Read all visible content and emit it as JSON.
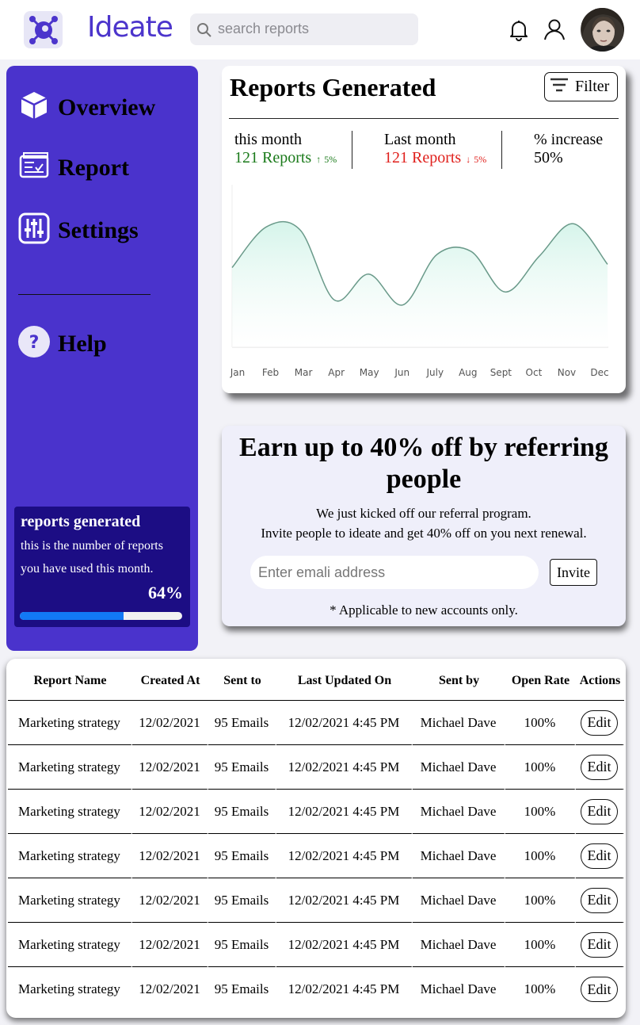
{
  "header": {
    "brand": "Ideate",
    "search_placeholder": "search reports"
  },
  "sidebar": {
    "items": [
      {
        "label": "Overview",
        "icon": "box-icon"
      },
      {
        "label": "Report",
        "icon": "report-icon"
      },
      {
        "label": "Settings",
        "icon": "sliders-icon"
      },
      {
        "label": "Help",
        "icon": "help-icon"
      }
    ],
    "usage": {
      "title": "reports generated",
      "desc_line1": "this is the number of reports",
      "desc_line2": "you have used this month.",
      "percent_label": "64%",
      "percent_value": 0.64
    }
  },
  "reports": {
    "title": "Reports Generated",
    "filter_label": "Filter",
    "stats": [
      {
        "label": "this month",
        "value": "121 Reports",
        "change": "5%",
        "direction": "up",
        "color": "#1a7a1a"
      },
      {
        "label": "Last month",
        "value": "121 Reports",
        "change": "5%",
        "direction": "down",
        "color": "#e0201c"
      },
      {
        "label": "% increase",
        "value": "50%"
      }
    ],
    "arrow_up": "↑",
    "arrow_down": "↓"
  },
  "chart_data": {
    "type": "area",
    "categories": [
      "Jan",
      "Feb",
      "Mar",
      "Apr",
      "May",
      "Jun",
      "July",
      "Aug",
      "Sept",
      "Oct",
      "Nov",
      "Dec"
    ],
    "values": [
      49,
      74,
      72,
      29,
      45,
      26,
      57,
      59,
      34,
      56,
      76,
      51
    ],
    "ylim": [
      0,
      100
    ],
    "title": "",
    "xlabel": "",
    "ylabel": "",
    "line_color": "#6a9a8a",
    "fill_color": "#dcf5ee"
  },
  "referral": {
    "title": "Earn up to 40% off by referring people",
    "line1": "We just kicked off our referral program.",
    "line2": "Invite people to ideate and get 40% off on you next renewal.",
    "email_placeholder": "Enter emali address",
    "invite_label": "Invite",
    "note": "* Applicable to new accounts only."
  },
  "table": {
    "columns": [
      "Report Name",
      "Created At",
      "Sent to",
      "Last Updated On",
      "Sent by",
      "Open Rate",
      "Actions"
    ],
    "action_label": "Edit",
    "rows": [
      [
        "Marketing strategy",
        "12/02/2021",
        "95 Emails",
        "12/02/2021 4:45 PM",
        "Michael Dave",
        "100%"
      ],
      [
        "Marketing strategy",
        "12/02/2021",
        "95 Emails",
        "12/02/2021 4:45 PM",
        "Michael Dave",
        "100%"
      ],
      [
        "Marketing strategy",
        "12/02/2021",
        "95 Emails",
        "12/02/2021 4:45 PM",
        "Michael Dave",
        "100%"
      ],
      [
        "Marketing strategy",
        "12/02/2021",
        "95 Emails",
        "12/02/2021 4:45 PM",
        "Michael Dave",
        "100%"
      ],
      [
        "Marketing strategy",
        "12/02/2021",
        "95 Emails",
        "12/02/2021 4:45 PM",
        "Michael Dave",
        "100%"
      ],
      [
        "Marketing strategy",
        "12/02/2021",
        "95 Emails",
        "12/02/2021 4:45 PM",
        "Michael Dave",
        "100%"
      ],
      [
        "Marketing strategy",
        "12/02/2021",
        "95 Emails",
        "12/02/2021 4:45 PM",
        "Michael Dave",
        "100%"
      ]
    ]
  },
  "colors": {
    "brand": "#4c35cc",
    "sidebar": "#4a33cc",
    "usage_panel": "#1c0d84",
    "progress": "#1279f5"
  }
}
